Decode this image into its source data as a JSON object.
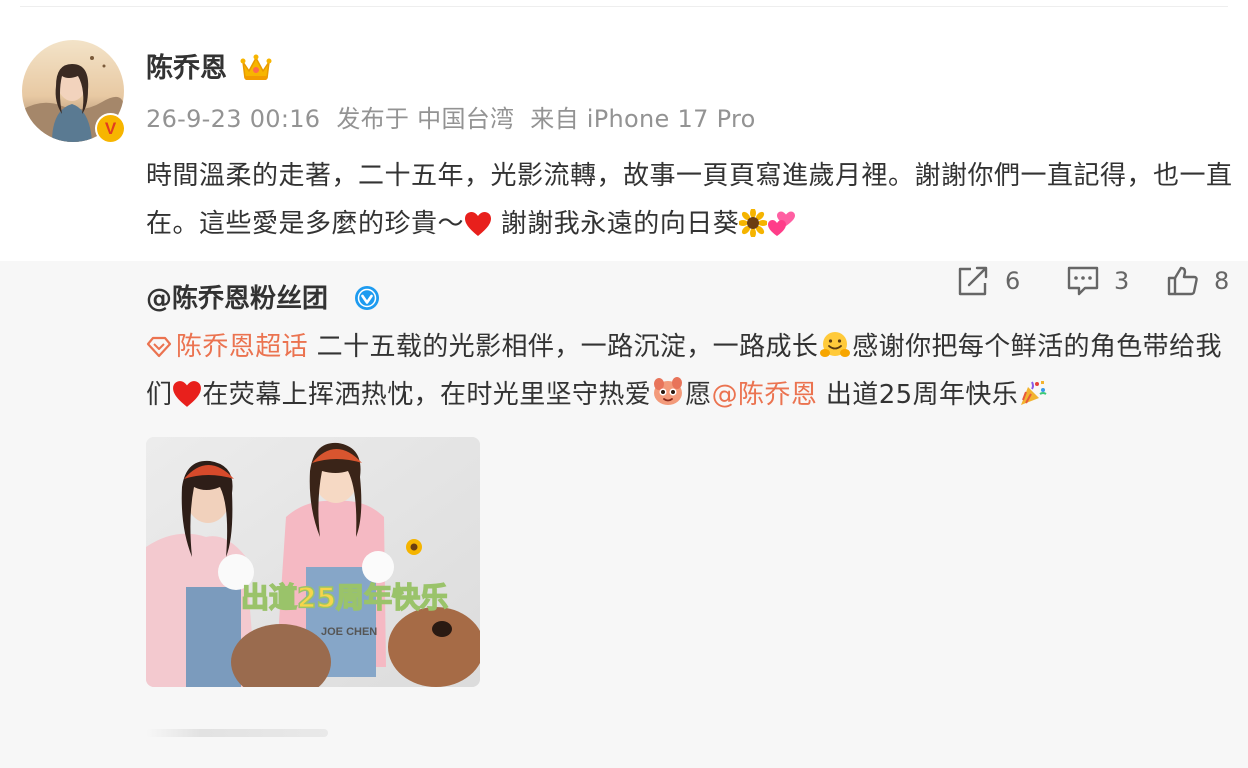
{
  "post": {
    "author": "陈乔恩",
    "meta": {
      "time": "26-9-23 00:16",
      "location": "发布于 中国台湾",
      "device": "来自 iPhone 17 Pro"
    },
    "text_parts": {
      "p1": "時間溫柔的走著，二十五年，光影流轉，故事一頁頁寫進歲月裡。謝謝你們一直記得，也一直在。這些愛是多麼的珍貴～",
      "p2": " 謝謝我永遠的向日葵"
    }
  },
  "repost": {
    "author": "@陈乔恩粉丝团",
    "topic": "陈乔恩超话",
    "text_parts": {
      "p1": " 二十五载的光影相伴，一路沉淀，一路成长",
      "p2": "感谢你把每个鲜活的角色带给我们",
      "p3": "在荧幕上挥洒热忱，在时光里坚守热爱",
      "p4": "愿",
      "mention": "@陈乔恩",
      "p5": " 出道25周年快乐"
    },
    "image": {
      "headline": "出道25周年快乐",
      "watermark": "JOE CHEN"
    }
  },
  "actions": {
    "share_count": "6",
    "comment_count": "3",
    "like_count": "8"
  },
  "colors": {
    "link": "#eb7350",
    "meta": "#939393",
    "repost_bg": "#f7f7f7",
    "verified_blue": "#1d9bf0",
    "verified_gold": "#f7b500"
  },
  "icons": [
    "crown-icon",
    "verified-badge-icon",
    "heart-icon",
    "sunflower-icon",
    "two-hearts-icon",
    "blue-verified-icon",
    "topic-diamond-icon",
    "hugging-face-icon",
    "face-emoji-icon",
    "party-popper-icon",
    "share-icon",
    "comment-icon",
    "like-icon"
  ]
}
